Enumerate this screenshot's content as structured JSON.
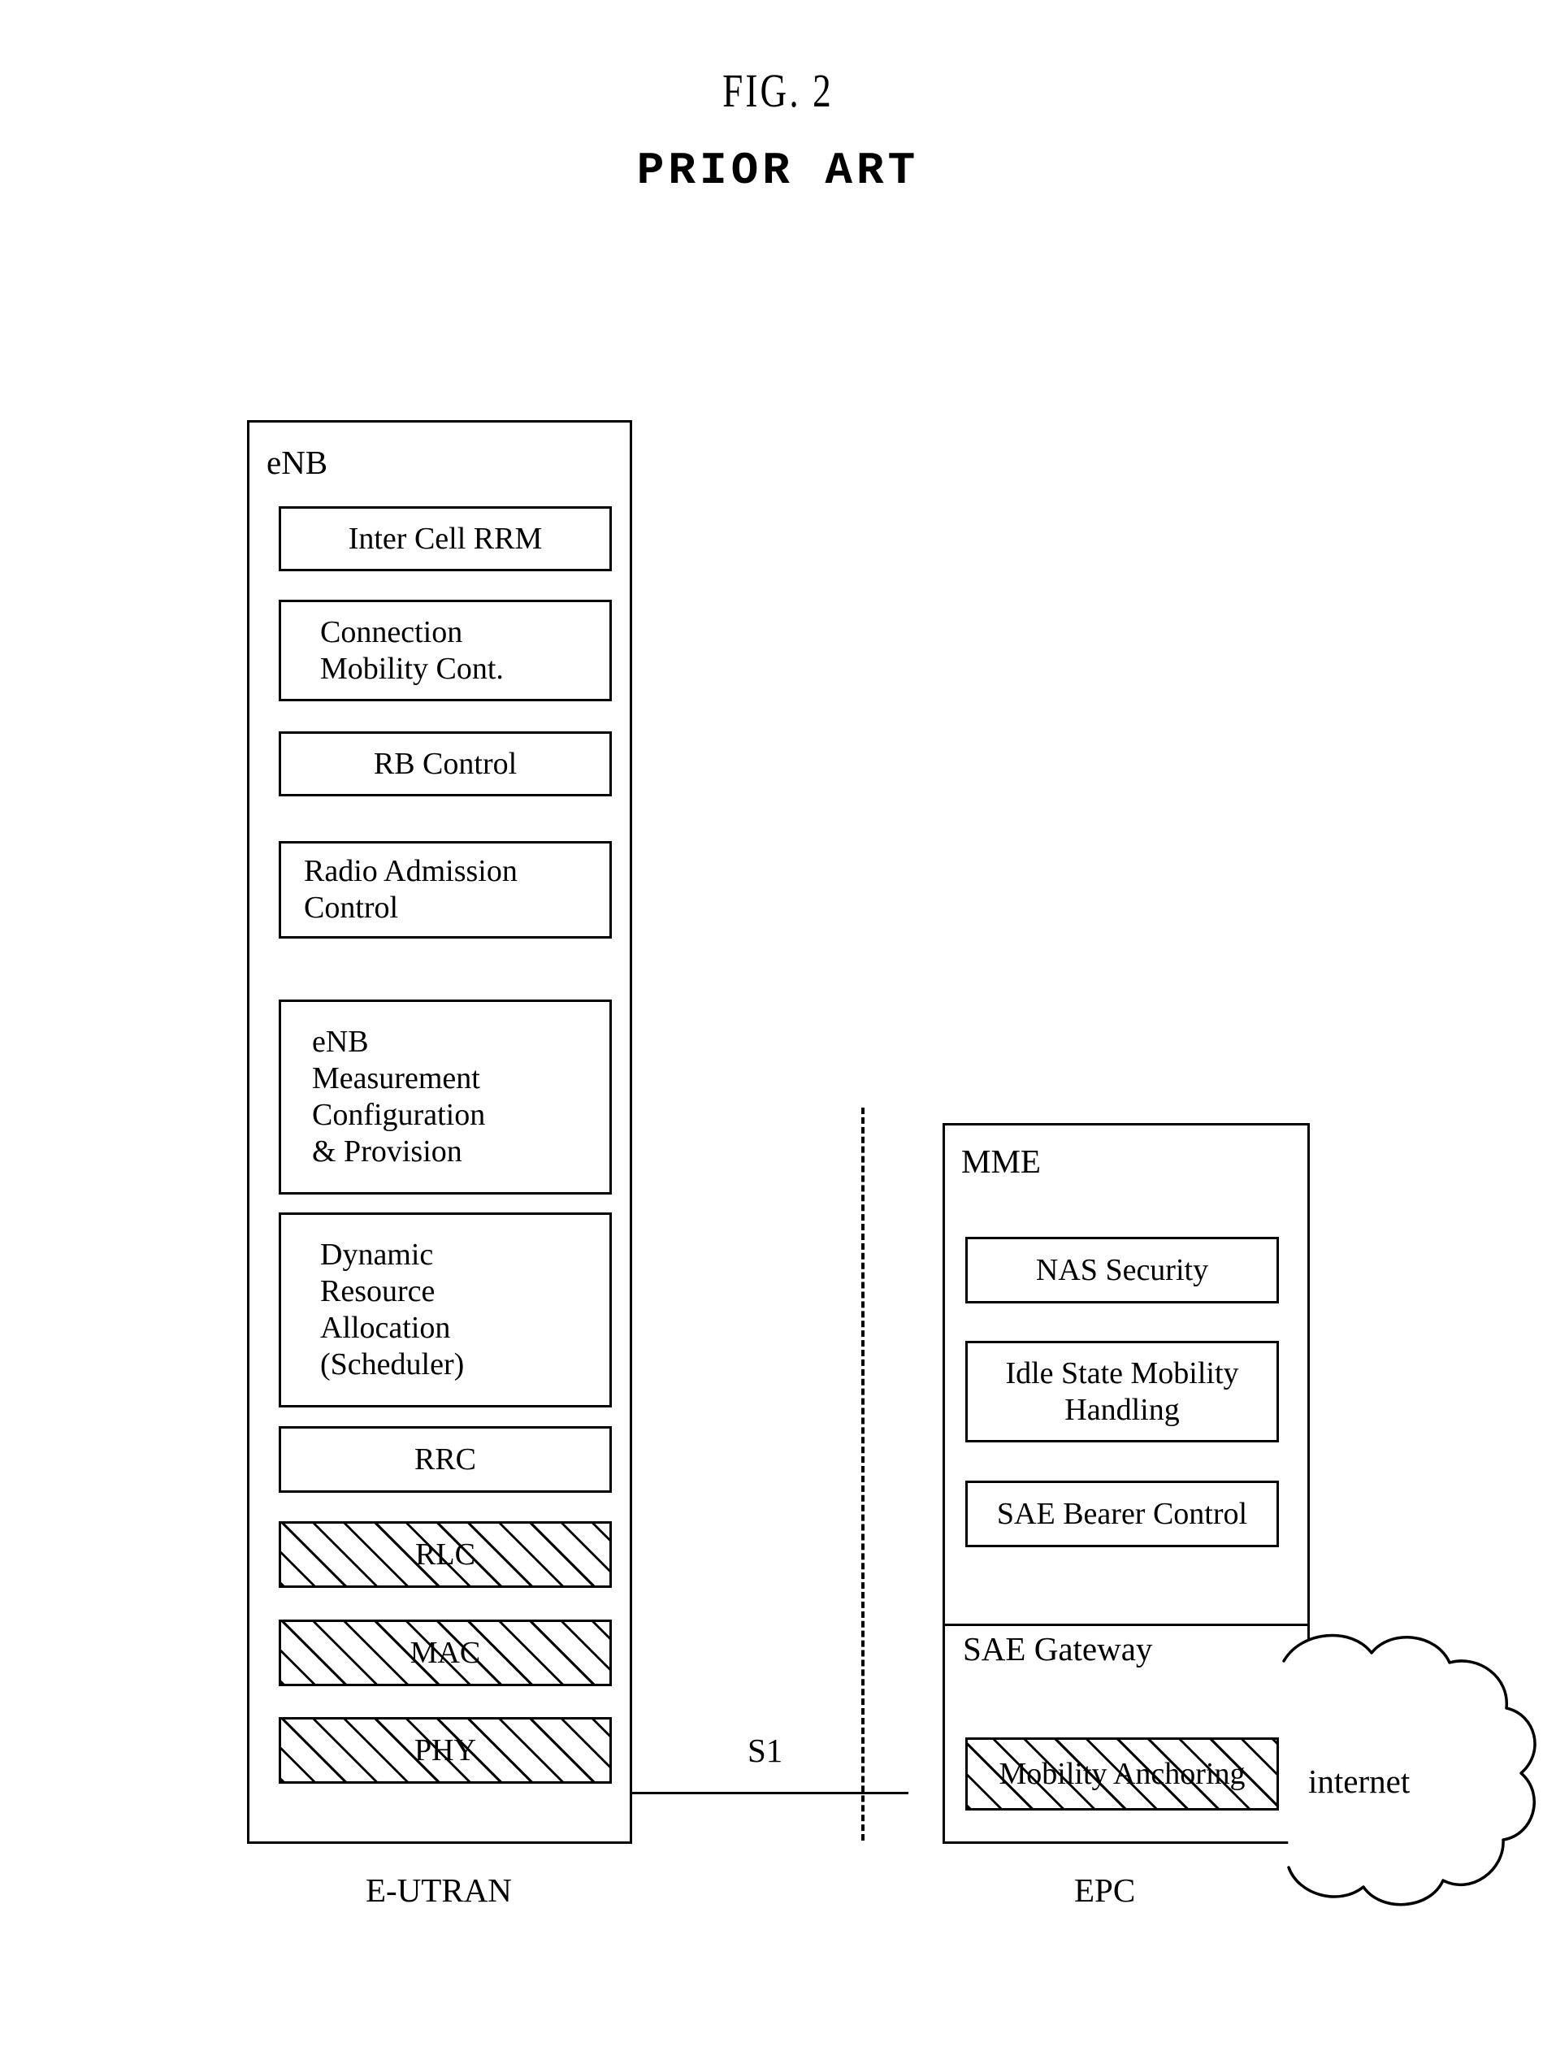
{
  "figure": {
    "title": "FIG. 2",
    "subtitle": "PRIOR ART"
  },
  "enb_panel": {
    "label": "eNB",
    "caption": "E-UTRAN",
    "blocks": [
      {
        "name": "inter-cell-rrm",
        "text": "Inter Cell RRM",
        "align": "center",
        "hatched": false
      },
      {
        "name": "connection-mobility",
        "text": "Connection\nMobility Cont.",
        "align": "left",
        "hatched": false
      },
      {
        "name": "rb-control",
        "text": "RB Control",
        "align": "center",
        "hatched": false
      },
      {
        "name": "radio-admission",
        "text": "Radio Admission\nControl",
        "align": "left",
        "hatched": false
      },
      {
        "name": "enb-measurement",
        "text": "eNB\nMeasurement\nConfiguration\n& Provision",
        "align": "left",
        "hatched": false
      },
      {
        "name": "dynamic-resource",
        "text": "Dynamic\nResource\nAllocation\n(Scheduler)",
        "align": "left",
        "hatched": false
      },
      {
        "name": "rrc",
        "text": "RRC",
        "align": "center",
        "hatched": false
      },
      {
        "name": "rlc",
        "text": "RLC",
        "align": "center",
        "hatched": true
      },
      {
        "name": "mac",
        "text": "MAC",
        "align": "center",
        "hatched": true
      },
      {
        "name": "phy",
        "text": "PHY",
        "align": "center",
        "hatched": true
      }
    ]
  },
  "interface": {
    "s1_label": "S1"
  },
  "epc_panel": {
    "caption": "EPC",
    "mme": {
      "label": "MME",
      "blocks": [
        {
          "name": "nas-security",
          "text": "NAS Security",
          "align": "center",
          "hatched": false
        },
        {
          "name": "idle-state-mobility",
          "text": "Idle State Mobility\nHandling",
          "align": "center",
          "hatched": false
        },
        {
          "name": "sae-bearer-control",
          "text": "SAE Bearer Control",
          "align": "center",
          "hatched": false
        }
      ]
    },
    "sae_gateway": {
      "label": "SAE Gateway",
      "blocks": [
        {
          "name": "mobility-anchoring",
          "text": "Mobility Anchoring",
          "align": "center",
          "hatched": true
        }
      ]
    }
  },
  "network": {
    "cloud_label": "internet"
  },
  "colors": {
    "stroke": "#000000",
    "background": "#ffffff"
  }
}
